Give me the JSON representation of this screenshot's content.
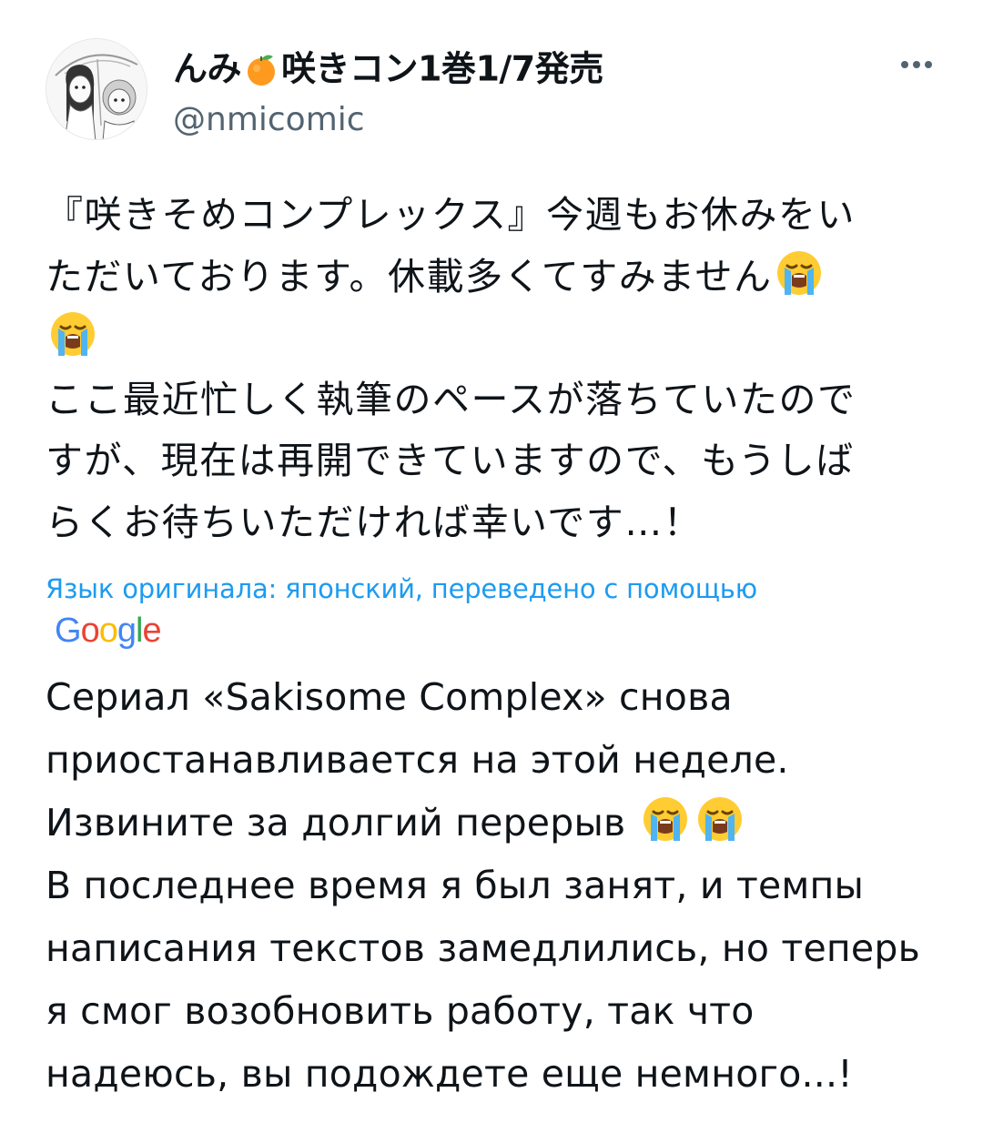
{
  "author": {
    "name_prefix": "んみ",
    "name_suffix": "咲きコン1巻1/7発売",
    "handle": "@nmicomic",
    "avatar_icon": "manga-girls-umbrella-avatar",
    "orange_icon": "tangerine-emoji"
  },
  "tweet": {
    "line1": "『咲きそめコンプレックス』今週もお休みをい",
    "line2": "ただいております。休載多くてすみません",
    "line4": "ここ最近忙しく執筆のペースが落ちていたので",
    "line5": "すが、現在は再開できていますので、もうしば",
    "line6": "らくお待ちいただければ幸いです…！",
    "emoji_name": "loudly-crying-face"
  },
  "translation": {
    "label": "Язык оригинала: японский, переведено с помощью",
    "provider": "Google",
    "line1": "Сериал «Sakisome Complex» снова",
    "line2": "приостанавливается на этой неделе.",
    "line3": "Извините за долгий перерыв",
    "line4": "В последнее время я был занят, и темпы",
    "line5": "написания текстов замедлились, но теперь",
    "line6": "я смог возобновить работу, так что",
    "line7": "надеюсь, вы подождете еще немного...!"
  },
  "colors": {
    "text": "#0f1419",
    "secondary": "#536471",
    "link": "#1d9bf0"
  }
}
